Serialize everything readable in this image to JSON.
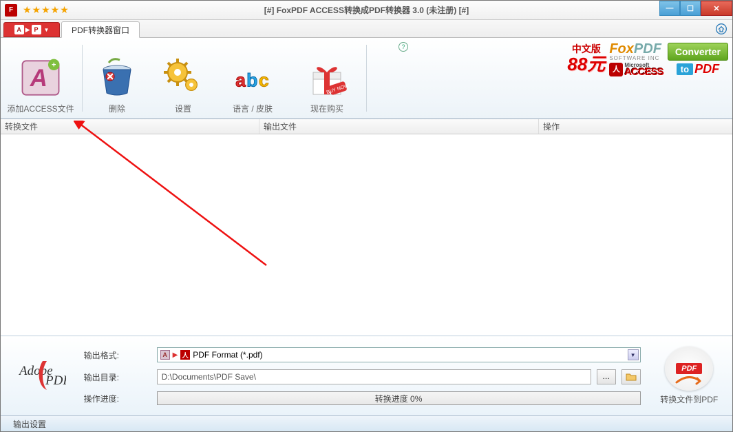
{
  "title": "[#] FoxPDF ACCESS转换成PDF转换器 3.0 (未注册) [#]",
  "tabs": {
    "main": "PDF转换器窗口"
  },
  "toolbar": {
    "add": "添加ACCESS文件",
    "delete": "删除",
    "settings": "设置",
    "lang": "语言 / 皮肤",
    "buy": "现在购买"
  },
  "promo": {
    "cn": "中文版",
    "price": "88元"
  },
  "brand": {
    "foxpdf": "FoxPDF",
    "sub": "SOFTWARE INC",
    "converter": "Converter",
    "ms": "Microsoft",
    "access": "ACCESS",
    "to": "to",
    "pdf": "PDF"
  },
  "columns": {
    "c1": "转换文件",
    "c2": "输出文件",
    "c3": "操作"
  },
  "bottom": {
    "adobe": "Adobe PDF",
    "outfmt_label": "输出格式:",
    "outfmt_value": "PDF Format (*.pdf)",
    "outdir_label": "输出目录:",
    "outdir_value": "D:\\Documents\\PDF Save\\",
    "progress_label": "操作进度:",
    "progress_text": "转换进度 0%",
    "convert_label": "转换文件到PDF",
    "pdf_badge": "PDF"
  },
  "footer": "输出设置"
}
